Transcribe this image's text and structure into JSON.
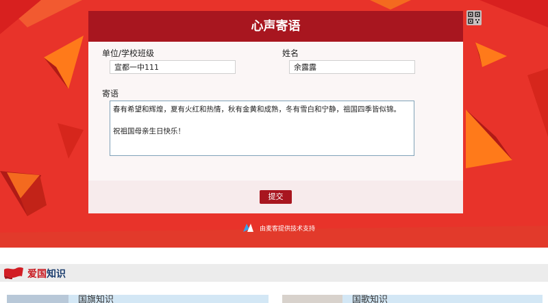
{
  "form": {
    "title": "心声寄语",
    "unit_label": "单位/学校班级",
    "unit_value": "宣都一中111",
    "name_label": "姓名",
    "name_value": "余露露",
    "message_label": "寄语",
    "message_value": "春有希望和辉煌，夏有火红和热情，秋有金黄和成熟，冬有雪白和宁静，祖国四季皆似锦。\n\n祝祖国母亲生日快乐！",
    "submit_label": "提交"
  },
  "support_text": "由麦客提供技术支持",
  "section": {
    "title_accent": "爱国",
    "title_rest": "知识"
  },
  "cards": [
    {
      "title": "国旗知识"
    },
    {
      "title": "国歌知识"
    }
  ],
  "colors": {
    "hero_red": "#e8332a",
    "header_dark_red": "#a8161f",
    "accent_orange": "#ff7a1a"
  },
  "icons": [
    "qr-code-icon",
    "maike-logo-icon",
    "flag-icon"
  ]
}
